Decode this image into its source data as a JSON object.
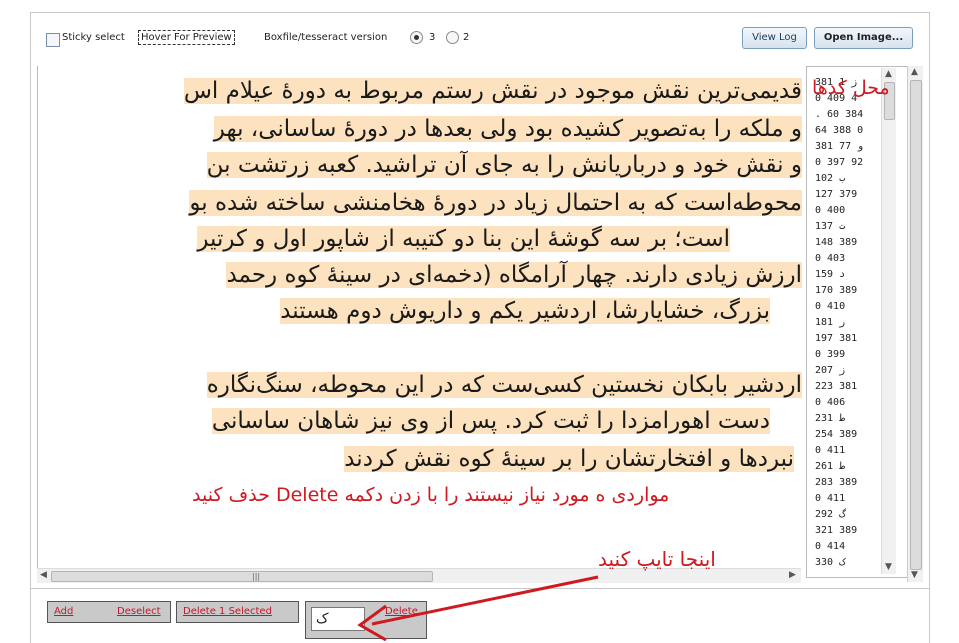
{
  "toolbar": {
    "sticky_select_label": "Sticky select",
    "hover_preview_label": "Hover For Preview",
    "version_label": "Boxfile/tesseract version",
    "version_options": [
      "3",
      "2"
    ],
    "selected_version": "3",
    "view_log_label": "View Log",
    "open_image_label": "Open Image..."
  },
  "image_text": {
    "lines": [
      "قدیمی‌ترین نقش موجود در نقش رستم مربوط به دورهٔ عیلام اس",
      "و ملکه را به‌تصویر کشیده بود ولی بعدها در دورهٔ ساسانی، بهر",
      "و نقش خود و درباریانش را به جای آن تراشید. کعبه زرتشت بن",
      "محوطه‌است که به احتمال زیاد در دورهٔ هخامنشی ساخته شده بو",
      "است؛ بر سه گوشهٔ این بنا دو کتیبه از شاپور اول و کرتیر",
      "ارزش زیادی دارند. چهار آرامگاه (دخمه‌ای در سینهٔ کوه رحمد",
      "بزرگ، خشایارشا، اردشیر یکم و داریوش دوم هستند",
      "اردشیر بابکان نخستین کسی‌ست که در این محوطه، سنگ‌نگاره",
      "دست اهورامزدا را ثبت کرد. پس از وی نیز شاهان ساسانی",
      "نبردها و افتخارتشان را بر سینهٔ کوه نقش کردند"
    ]
  },
  "codes_list": [
    "381 ز 1",
    "0 409 4",
    ". 60 384",
    "64 388 0",
    "و 77 381",
    "0 397 92",
    "ب 102",
    "127 379",
    "0 400",
    "ت 137",
    "148 389",
    "0 403",
    "د 159",
    "170 389",
    "0 410",
    "ر 181",
    "197 381",
    "0 399",
    "ز 207",
    "223 381",
    "0 406",
    "ط 231",
    "254 389",
    "0 411",
    "ط 261",
    "283 389",
    "0 411",
    "گ 292",
    "321 389",
    "0 414",
    "ک 330"
  ],
  "bottom": {
    "add_label": "Add",
    "deselect_label": "Deselect",
    "delete_selected_label": "Delete 1 Selected",
    "char_value": "ک",
    "delete_label": "Delete"
  },
  "annotations": {
    "codes_title": "محل کدها",
    "delete_hint": "مواردی ه مورد نیاز نیستند را با زدن دکمه Delete   حذف کنید",
    "type_here": "اینجا تایپ کنید"
  },
  "colors": {
    "annotation": "#d0181f",
    "box_highlight": "#fde2bf",
    "link": "#c0182d"
  }
}
